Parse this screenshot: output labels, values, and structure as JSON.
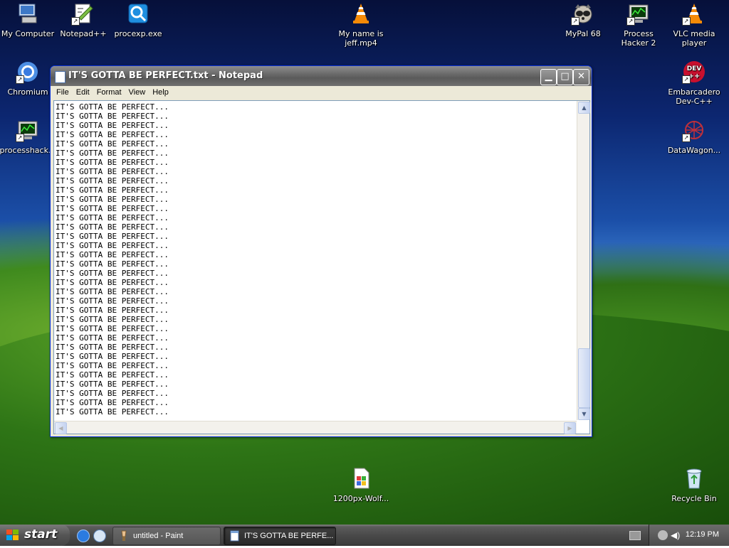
{
  "desktop_icons": [
    {
      "id": "my-computer",
      "label": "My Computer",
      "icon": "computer-icon",
      "shortcut": false
    },
    {
      "id": "notepadpp",
      "label": "Notepad++",
      "icon": "notepadpp-icon",
      "shortcut": true
    },
    {
      "id": "procexp",
      "label": "procexp.exe",
      "icon": "procexp-icon",
      "shortcut": false
    },
    {
      "id": "jeff",
      "label": "My name is jeff.mp4",
      "icon": "vlc-cone-icon",
      "shortcut": false
    },
    {
      "id": "mypal",
      "label": "MyPal 68",
      "icon": "mypal-icon",
      "shortcut": true
    },
    {
      "id": "processhacker2",
      "label": "Process Hacker 2",
      "icon": "processhacker-icon",
      "shortcut": true
    },
    {
      "id": "vlc",
      "label": "VLC media player",
      "icon": "vlc-cone-icon",
      "shortcut": true
    },
    {
      "id": "chromium",
      "label": "Chromium",
      "icon": "chromium-icon",
      "shortcut": true
    },
    {
      "id": "devcpp",
      "label": "Embarcadero Dev-C++",
      "icon": "devcpp-icon",
      "shortcut": true
    },
    {
      "id": "processhack",
      "label": "processhack...",
      "icon": "processhacker-icon",
      "shortcut": true
    },
    {
      "id": "datawagon",
      "label": "DataWagon...",
      "icon": "datawagon-icon",
      "shortcut": true
    },
    {
      "id": "wolf",
      "label": "1200px-Wolf...",
      "icon": "image-file-icon",
      "shortcut": false
    },
    {
      "id": "recycle",
      "label": "Recycle Bin",
      "icon": "recycle-bin-icon",
      "shortcut": false
    }
  ],
  "notepad": {
    "title": "IT'S GOTTA BE PERFECT.txt - Notepad",
    "menu": [
      "File",
      "Edit",
      "Format",
      "View",
      "Help"
    ],
    "line_text": "IT'S GOTTA BE PERFECT...",
    "line_count": 34,
    "vertical_scroll_position": 0.95
  },
  "taskbar": {
    "start_label": "start",
    "items": [
      {
        "label": "untitled - Paint",
        "active": false
      },
      {
        "label": "IT'S GOTTA BE PERFE...",
        "active": true
      }
    ],
    "clock": "12:19 PM"
  },
  "colors": {
    "titlebar_inactive": "#6a6a6a",
    "taskbar": "#4a4a4a",
    "window_face": "#ece9d8"
  }
}
